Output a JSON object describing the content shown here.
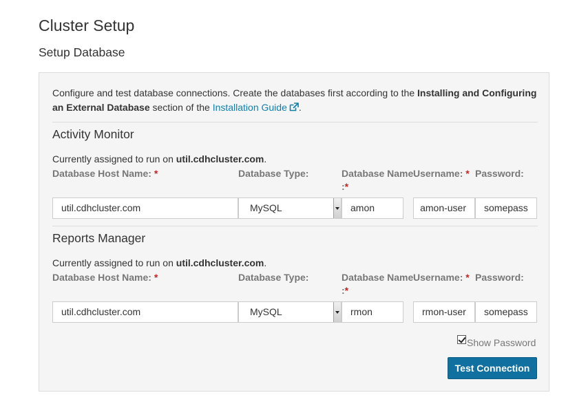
{
  "page": {
    "title": "Cluster Setup",
    "subtitle": "Setup Database"
  },
  "intro": {
    "text_start": "Configure and test database connections. Create the databases first according to the ",
    "bold_text": "Installing and Configuring an External Database",
    "text_mid": " section of the ",
    "link_text": "Installation Guide",
    "link_icon": "external-link-icon",
    "text_end": "."
  },
  "labels": {
    "host": "Database Host Name:",
    "type": "Database Type:",
    "name": "Database Name",
    "name_colon": ":",
    "username": "Username:",
    "password": "Password:",
    "required_mark": "*",
    "assigned_prefix": "Currently assigned to run on ",
    "assigned_suffix": "."
  },
  "sections": [
    {
      "title": "Activity Monitor",
      "host_assigned": "util.cdhcluster.com",
      "host_value": "util.cdhcluster.com",
      "db_type": "MySQL",
      "db_name": "amon",
      "username": "amon-user",
      "password": "somepass"
    },
    {
      "title": "Reports Manager",
      "host_assigned": "util.cdhcluster.com",
      "host_value": "util.cdhcluster.com",
      "db_type": "MySQL",
      "db_name": "rmon",
      "username": "rmon-user",
      "password": "somepass"
    }
  ],
  "show_password": {
    "label": "Show Password",
    "checked": true
  },
  "test_button": "Test Connection",
  "colors": {
    "accent": "#1070a0",
    "link": "#0e7fab",
    "required": "#c12626",
    "panel_bg": "#f5f5f5"
  }
}
